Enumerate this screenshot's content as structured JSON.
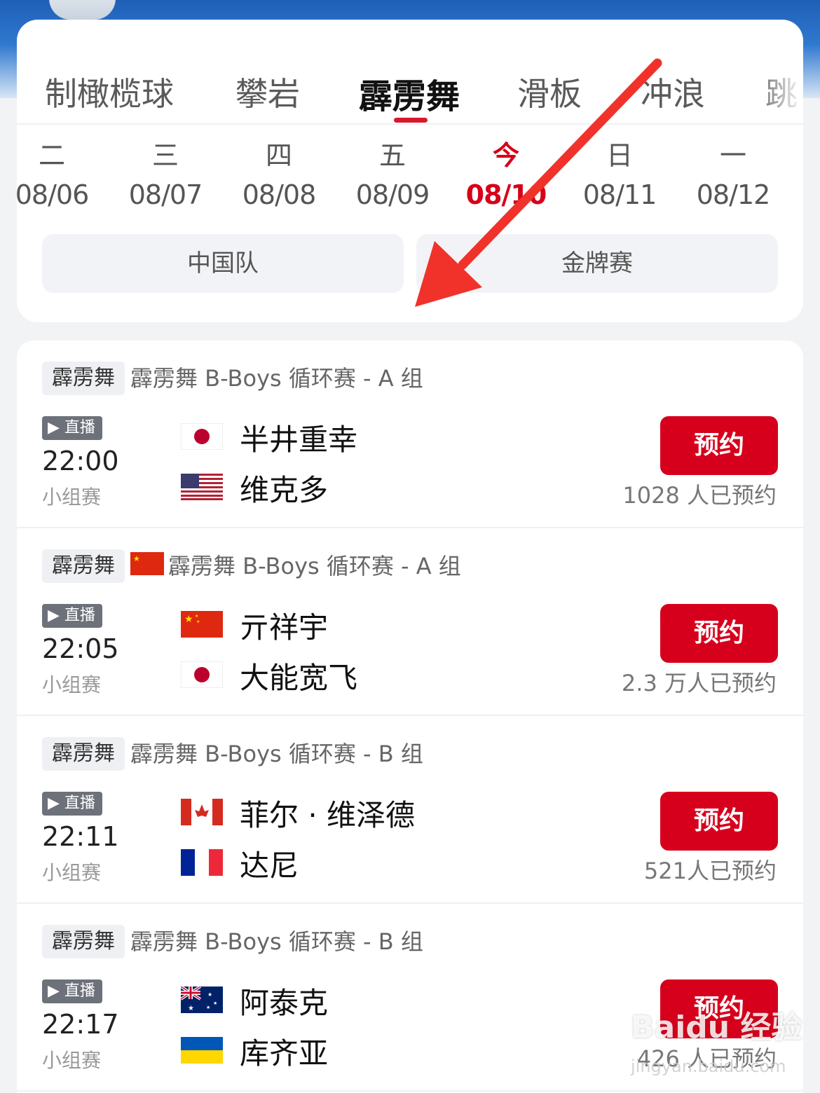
{
  "tabs": [
    "制橄榄球",
    "攀岩",
    "霹雳舞",
    "滑板",
    "冲浪",
    "跳"
  ],
  "dates": [
    {
      "weekday": "二",
      "date": "08/06"
    },
    {
      "weekday": "三",
      "date": "08/07"
    },
    {
      "weekday": "四",
      "date": "08/08"
    },
    {
      "weekday": "五",
      "date": "08/09"
    },
    {
      "weekday": "今",
      "date": "08/10",
      "today": true
    },
    {
      "weekday": "日",
      "date": "08/11"
    },
    {
      "weekday": "一",
      "date": "08/12"
    }
  ],
  "filters": [
    "中国队",
    "金牌赛"
  ],
  "live_label": "直播",
  "reserve_label": "预约",
  "matches": [
    {
      "tag": "霹雳舞",
      "title": "霹雳舞 B-Boys 循环赛 - A 组",
      "time": "22:00",
      "round": "小组赛",
      "p1": "半井重幸",
      "p1_flag": "japan",
      "p2": "维克多",
      "p2_flag": "usa",
      "reserved": "1028 人已预约"
    },
    {
      "tag": "霹雳舞",
      "title": "霹雳舞 B-Boys 循环赛 - A 组",
      "time": "22:05",
      "round": "小组赛",
      "p1": "亓祥宇",
      "p1_flag": "china",
      "p2": "大能宽飞",
      "p2_flag": "japan",
      "reserved": "2.3 万人已预约",
      "china_team": true
    },
    {
      "tag": "霹雳舞",
      "title": "霹雳舞 B-Boys 循环赛 - B 组",
      "time": "22:11",
      "round": "小组赛",
      "p1": "菲尔 · 维泽德",
      "p1_flag": "canada",
      "p2": "达尼",
      "p2_flag": "france",
      "reserved": "521人已预约"
    },
    {
      "tag": "霹雳舞",
      "title": "霹雳舞 B-Boys 循环赛 - B 组",
      "time": "22:17",
      "round": "小组赛",
      "p1": "阿泰克",
      "p1_flag": "australia",
      "p2": "库齐亚",
      "p2_flag": "ukraine",
      "reserved": "426 人已预约"
    }
  ],
  "watermark": {
    "text": "Baidu 经验",
    "sub": "jingyan.baidu.com"
  },
  "colors": {
    "accent": "#d6001c",
    "today": "#d60018",
    "annotation_arrow": "#f0322b"
  }
}
